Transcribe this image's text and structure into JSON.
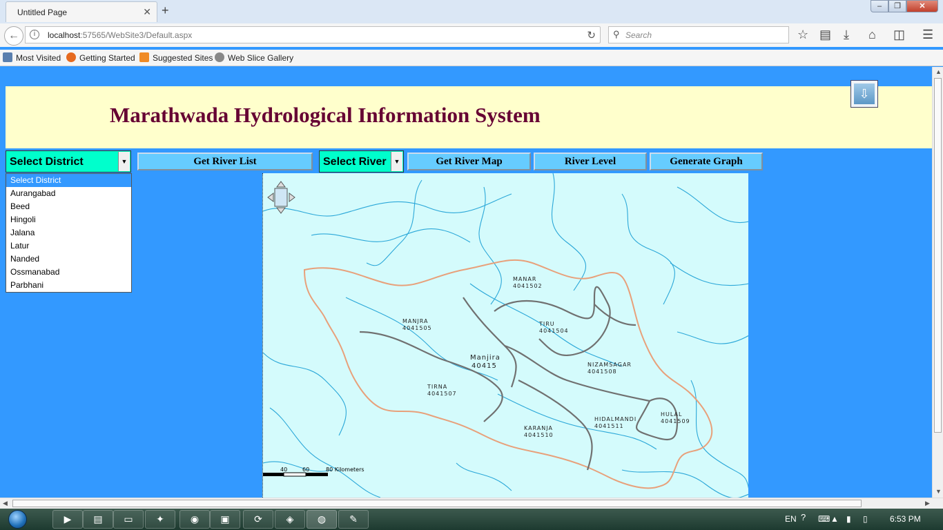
{
  "browser": {
    "tab_title": "Untitled Page",
    "url_host": "localhost",
    "url_rest": ":57565/WebSite3/Default.aspx",
    "search_placeholder": "Search",
    "bookmarks": [
      "Most Visited",
      "Getting Started",
      "Suggested Sites",
      "Web Slice Gallery"
    ]
  },
  "header": {
    "title": "Marathwada Hydrological Information System"
  },
  "controls": {
    "district_select": "Select District",
    "get_river_list": "Get River List",
    "river_select": "Select River",
    "get_river_map": "Get  River Map",
    "river_level": "River Level",
    "generate_graph": "Generate Graph"
  },
  "district_options": [
    "Select District",
    "Aurangabad",
    "Beed",
    "Hingoli",
    "Jalana",
    "Latur",
    "Nanded",
    "Ossmanabad",
    "Parbhani"
  ],
  "map": {
    "basins": [
      {
        "name": "MANAR",
        "code": "4041502"
      },
      {
        "name": "MANJRA",
        "code": "4041505"
      },
      {
        "name": "TIRU",
        "code": "4041504"
      },
      {
        "name": "Manjira",
        "code": "40415"
      },
      {
        "name": "NIZAMSAGAR",
        "code": "4041508"
      },
      {
        "name": "TIRNA",
        "code": "4041507"
      },
      {
        "name": "HULAL",
        "code": "4041509"
      },
      {
        "name": "HIDALMANDI",
        "code": "4041511"
      },
      {
        "name": "KARANJA",
        "code": "4041510"
      }
    ],
    "scale_labels": [
      "40",
      "60",
      "80 Kilometers"
    ]
  },
  "taskbar": {
    "language": "EN",
    "time": "6:53 PM"
  },
  "colors": {
    "page_bg": "#3399ff",
    "header_bg": "#ffffcc",
    "title_color": "#660033",
    "select_bg": "#00ffcc",
    "button_bg": "#66ccff",
    "map_bg": "#d4fbfc"
  }
}
